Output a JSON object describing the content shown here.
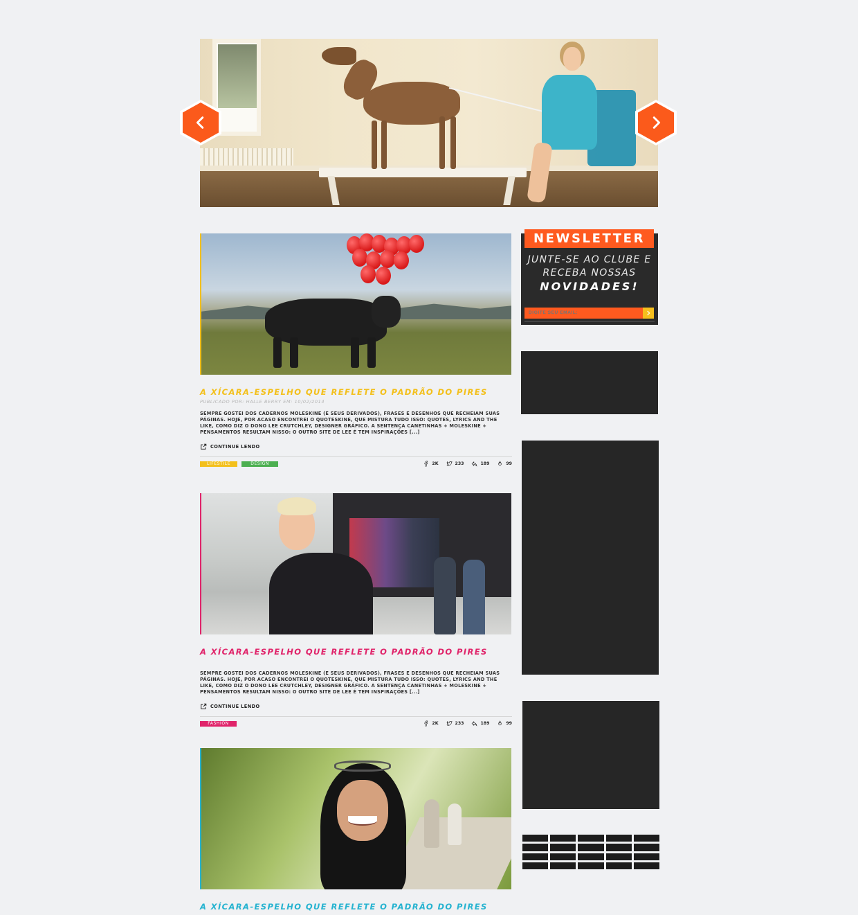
{
  "hero": {
    "prev_icon": "chevron-left-icon",
    "next_icon": "chevron-right-icon",
    "accent": "#fb5a1b"
  },
  "posts": [
    {
      "title": "A xícara-espelho que reflete o padrão do pires",
      "title_color": "#f3c01c",
      "meta": "Publicado por:  Halle Berry em: 10/02/2014",
      "excerpt": "Sempre gostei dos cadernos moleskine (e seus derivados), frases e desenhos que recheiam suas páginas. Hoje, por acaso encontrei o quoteskine, que mistura tudo isso: quotes, lyrics and the like, como diz o dono Lee Crutchley, designer gráfico. A sentença canetinhas + moleskine + pensamentos resultam nisso: o outro site de Lee é tem inspirações [...]",
      "continue_label": "Continue lendo",
      "tags": [
        {
          "label": "Lifestile",
          "color": "#f3c01c"
        },
        {
          "label": "Design",
          "color": "#4caf50"
        }
      ],
      "stats": {
        "facebook": "2K",
        "twitter": "233",
        "shares": "189",
        "likes": "99"
      }
    },
    {
      "title": "A xícara-espelho que reflete o padrão do pires",
      "title_color": "#e0246a",
      "excerpt": "Sempre gostei dos cadernos moleskine (e seus derivados), frases e desenhos que recheiam suas páginas. Hoje, por acaso encontrei o quoteskine, que mistura tudo isso: quotes, lyrics and the like, como diz o dono Lee Crutchley, designer gráfico. A sentença canetinhas + moleskine + pensamentos resultam nisso: o outro site de Lee é tem inspirações [...]",
      "continue_label": "Continue lendo",
      "tags": [
        {
          "label": "Fashion",
          "color": "#e0246a"
        }
      ],
      "stats": {
        "facebook": "2K",
        "twitter": "233",
        "shares": "189",
        "likes": "99"
      }
    },
    {
      "title": "A xícara-espelho que reflete o padrão do pires",
      "title_color": "#26b3d0"
    }
  ],
  "newsletter": {
    "title": "NEWSLETTER",
    "line1": "JUNTE-SE AO CLUBE E",
    "line2": "RECEBA NOSSAS",
    "line3": "NOVIDADES!",
    "input_placeholder": "DIGITE SEU EMAIL:",
    "accent": "#ff5a1f",
    "button_color": "#f6bf1d"
  }
}
